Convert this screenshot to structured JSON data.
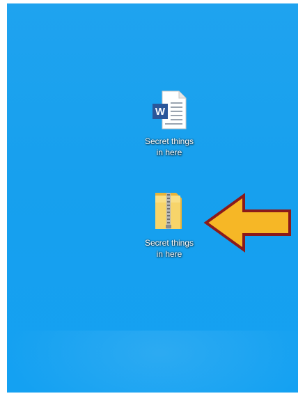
{
  "desktop": {
    "icons": [
      {
        "label": "Secret things\nin here",
        "type": "word-document",
        "icon": "word-document-icon"
      },
      {
        "label": "Secret things\nin here",
        "type": "zip-folder",
        "icon": "zip-folder-icon"
      }
    ],
    "pointer": {
      "icon": "arrow-left-icon",
      "fill": "#f6b726",
      "stroke": "#8b1a1a"
    }
  },
  "colors": {
    "desktop_background": "#1aa0ee",
    "word_blue": "#2b579a",
    "folder_yellow": "#f5c242"
  }
}
